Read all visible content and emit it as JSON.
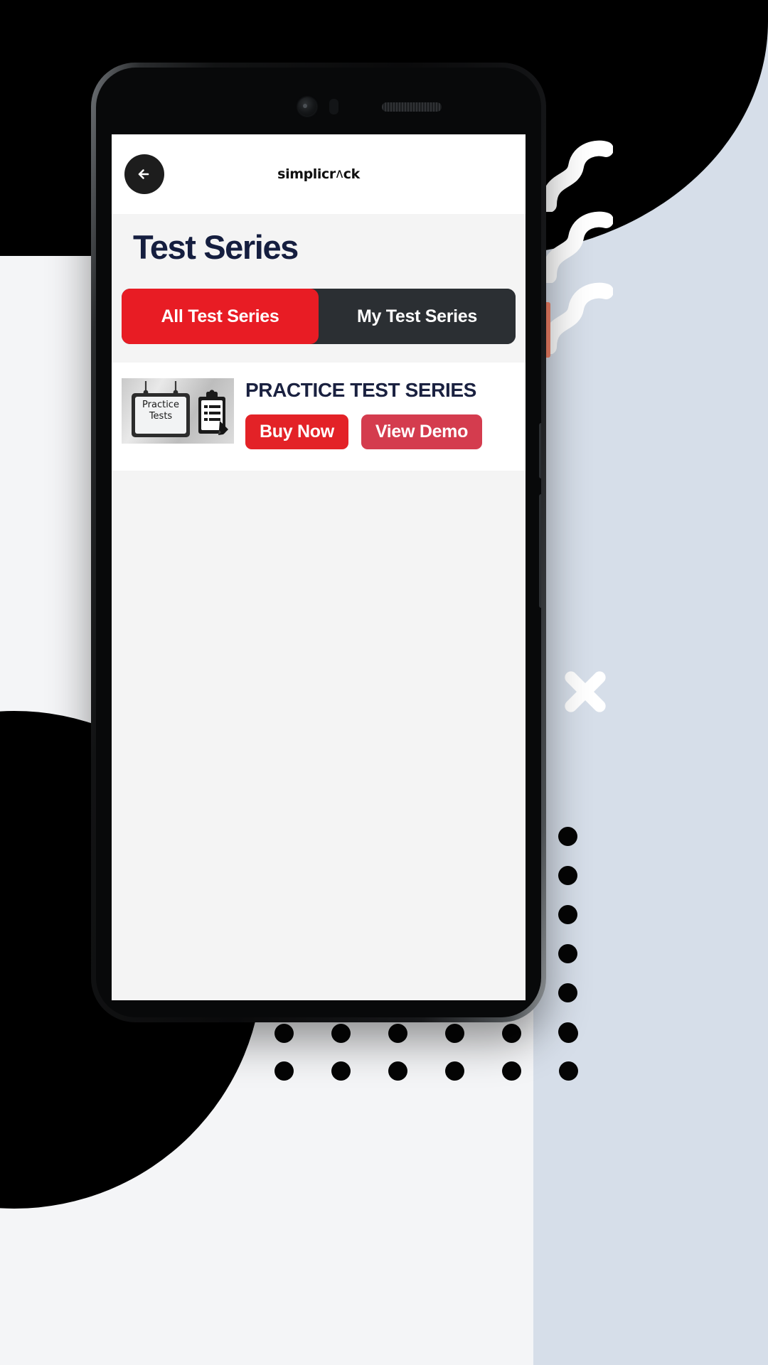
{
  "background": {
    "panel_color": "#D6DEE9",
    "blob_color": "#000000",
    "squiggle_color": "#FFFFFF",
    "accent_orange": "#F58368",
    "dot_color": "#050505",
    "x_icon_name": "x-decoration-icon"
  },
  "device": {
    "frame_color": "#0A0A0B",
    "camera_icon": "front-camera",
    "speaker_icon": "earpiece-speaker"
  },
  "appbar": {
    "back_icon": "arrow-left-icon",
    "brand_prefix": "simplicr",
    "brand_chevron": "ʌ",
    "brand_suffix": "ck",
    "brand_full": "simplicrʌck",
    "background": "#FFFFFF"
  },
  "header": {
    "title": "Test Series"
  },
  "tabs": {
    "active_index": 0,
    "active_color": "#E81C24",
    "inactive_color": "#2B2F33",
    "items": [
      {
        "label": "All Test Series",
        "active": true
      },
      {
        "label": "My Test Series",
        "active": false
      }
    ]
  },
  "card": {
    "thumbnail_name": "practice-tests-thumbnail",
    "thumbnail_sign_line1": "Practice",
    "thumbnail_sign_line2": "Tests",
    "title": "PRACTICE TEST SERIES",
    "buttons": [
      {
        "label": "Buy Now",
        "name": "buy-now-button",
        "color": "#E32227"
      },
      {
        "label": "View Demo",
        "name": "view-demo-button",
        "color": "#D43C4E"
      }
    ]
  },
  "colors": {
    "screen_background": "#F4F4F4",
    "card_background": "#FFFFFF",
    "title_navy": "#151E3F"
  }
}
